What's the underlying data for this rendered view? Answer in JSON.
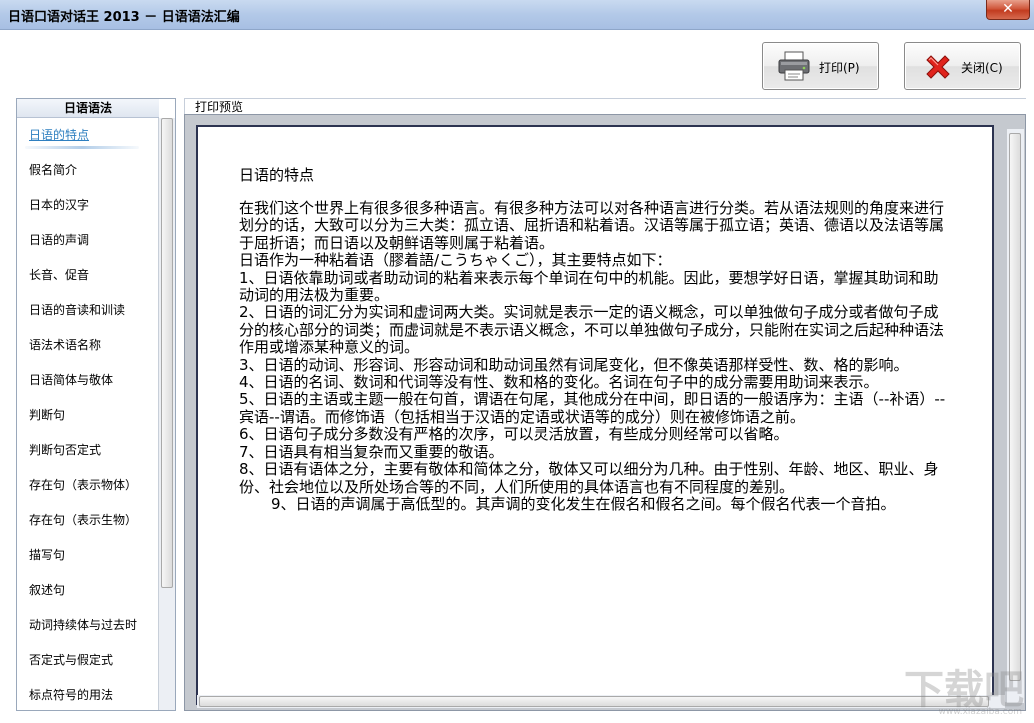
{
  "window": {
    "title": "日语口语对话王 2013 － 日语语法汇编",
    "close_glyph": "✕"
  },
  "toolbar": {
    "print_label": "打印(P)",
    "close_label": "关闭(C)"
  },
  "sidebar": {
    "header": "日语语法",
    "items": [
      {
        "label": "日语的特点",
        "active": true
      },
      {
        "label": "假名简介"
      },
      {
        "label": "日本的汉字"
      },
      {
        "label": "日语的声调"
      },
      {
        "label": "长音、促音"
      },
      {
        "label": "日语的音读和训读"
      },
      {
        "label": "语法术语名称"
      },
      {
        "label": "日语简体与敬体"
      },
      {
        "label": "判断句"
      },
      {
        "label": "判断句否定式"
      },
      {
        "label": "存在句（表示物体）"
      },
      {
        "label": "存在句（表示生物）"
      },
      {
        "label": "描写句"
      },
      {
        "label": "叙述句"
      },
      {
        "label": "动词持续体与过去时"
      },
      {
        "label": "否定式与假定式"
      },
      {
        "label": "标点符号的用法"
      }
    ]
  },
  "preview": {
    "label": "打印预览",
    "title": "日语的特点",
    "paragraphs": [
      "在我们这个世界上有很多很多种语言。有很多种方法可以对各种语言进行分类。若从语法规则的角度来进行划分的话，大致可以分为三大类：孤立语、屈折语和粘着语。汉语等属于孤立语；英语、德语以及法语等属于屈折语；而日语以及朝鲜语等则属于粘着语。",
      "日语作为一种粘着语（膠着語/こうちゃくご），其主要特点如下：",
      "1、日语依靠助词或者助动词的粘着来表示每个单词在句中的机能。因此，要想学好日语，掌握其助词和助动词的用法极为重要。",
      "2、日语的词汇分为实词和虚词两大类。实词就是表示一定的语义概念，可以单独做句子成分或者做句子成分的核心部分的词类；而虚词就是不表示语义概念，不可以单独做句子成分，只能附在实词之后起种种语法作用或增添某种意义的词。",
      "3、日语的动词、形容词、形容动词和助动词虽然有词尾变化，但不像英语那样受性、数、格的影响。",
      "4、日语的名词、数词和代词等没有性、数和格的变化。名词在句子中的成分需要用助词来表示。",
      "5、日语的主语或主题一般在句首，谓语在句尾，其他成分在中间，即日语的一般语序为：主语（--补语）--宾语--谓语。而修饰语（包括相当于汉语的定语或状语等的成分）则在被修饰语之前。",
      "6、日语句子成分多数没有严格的次序，可以灵活放置，有些成分则经常可以省略。",
      "7、日语具有相当复杂而又重要的敬语。",
      "8、日语有语体之分，主要有敬体和简体之分，敬体又可以细分为几种。由于性别、年龄、地区、职业、身份、社会地位以及所处场合等的不同，人们所使用的具体语言也有不同程度的差别。",
      "9、日语的声调属于高低型的。其声调的变化发生在假名和假名之间。每个假名代表一个音拍。"
    ]
  },
  "watermark": {
    "main": "下载吧",
    "sub": "www.xiazaiba.com"
  }
}
